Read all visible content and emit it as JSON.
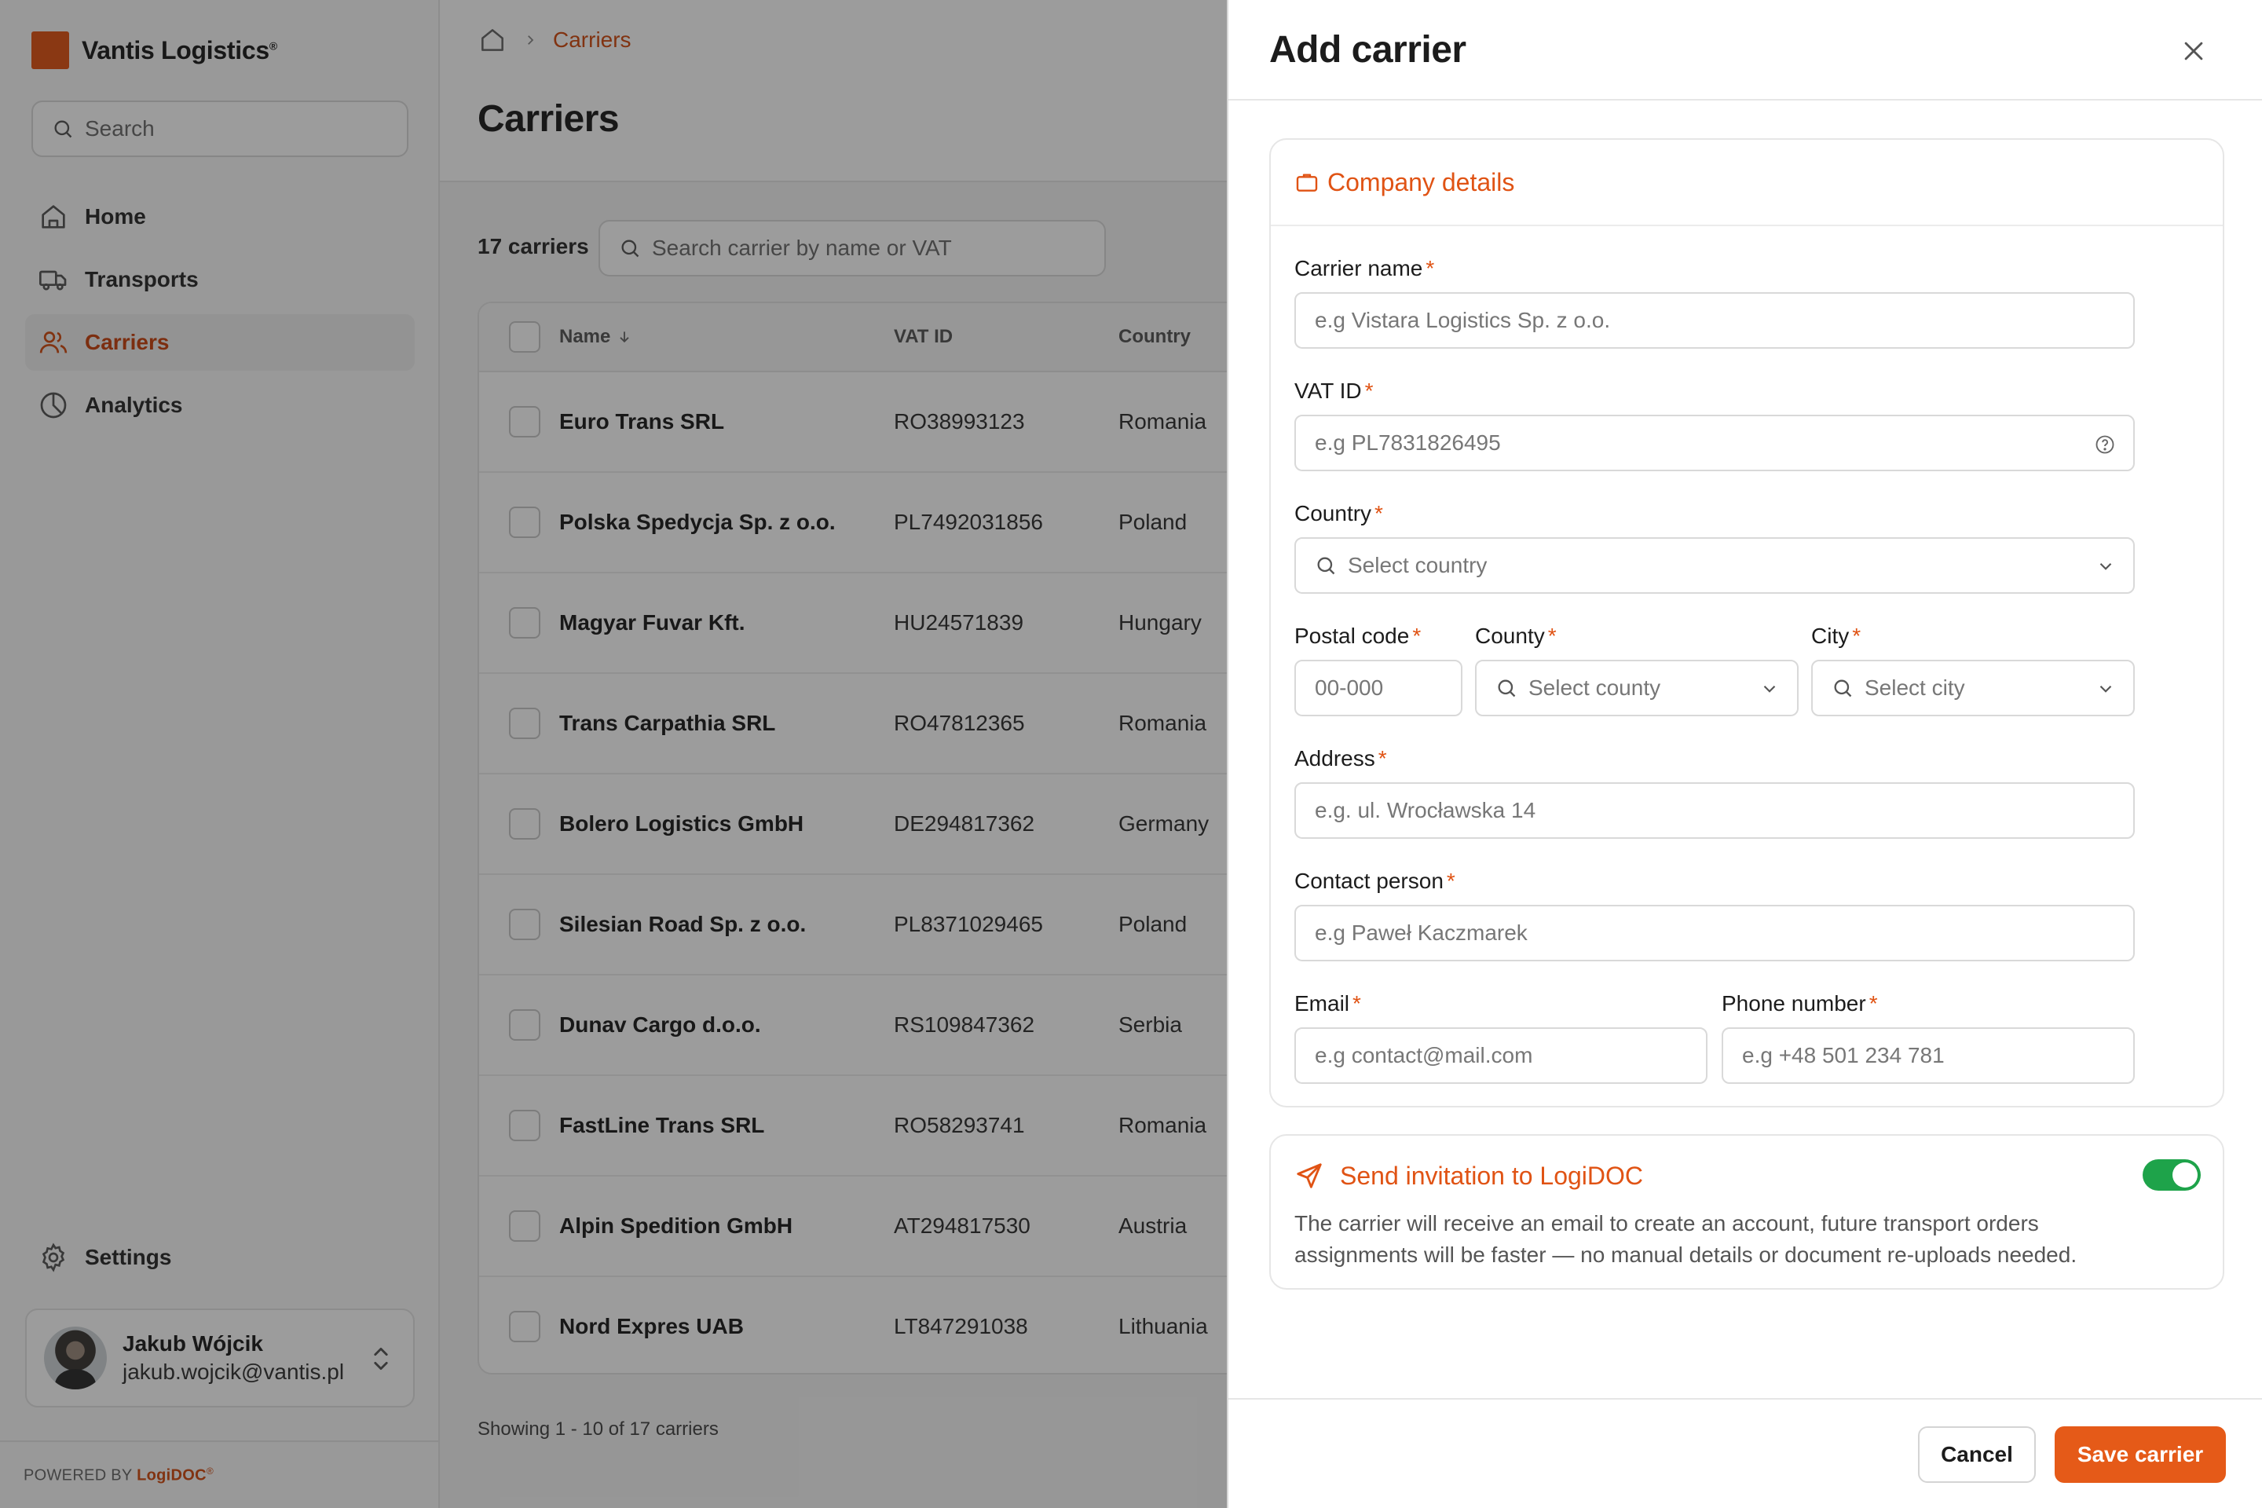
{
  "brand": {
    "name": "Vantis Logistics",
    "mark": "®"
  },
  "sidebar": {
    "search_placeholder": "Search",
    "items": [
      {
        "label": "Home",
        "icon": "home-icon"
      },
      {
        "label": "Transports",
        "icon": "truck-icon"
      },
      {
        "label": "Carriers",
        "icon": "users-icon",
        "active": true
      },
      {
        "label": "Analytics",
        "icon": "pie-chart-icon"
      }
    ],
    "settings_label": "Settings",
    "user": {
      "name": "Jakub Wójcik",
      "email": "jakub.wojcik@vantis.pl"
    },
    "powered_prefix": "POWERED BY",
    "powered_brand": "LogiDOC",
    "powered_mark": "®"
  },
  "main": {
    "breadcrumb": {
      "current": "Carriers"
    },
    "title": "Carriers",
    "count_label": "17 carriers",
    "search_placeholder": "Search carrier by name or VAT",
    "columns": {
      "name": "Name",
      "vat": "VAT ID",
      "country": "Country"
    },
    "rows": [
      {
        "name": "Euro Trans SRL",
        "vat": "RO38993123",
        "country": "Romania"
      },
      {
        "name": "Polska Spedycja Sp. z o.o.",
        "vat": "PL7492031856",
        "country": "Poland"
      },
      {
        "name": "Magyar Fuvar Kft.",
        "vat": "HU24571839",
        "country": "Hungary"
      },
      {
        "name": "Trans Carpathia SRL",
        "vat": "RO47812365",
        "country": "Romania"
      },
      {
        "name": "Bolero Logistics GmbH",
        "vat": "DE294817362",
        "country": "Germany"
      },
      {
        "name": "Silesian Road Sp. z o.o.",
        "vat": "PL8371029465",
        "country": "Poland"
      },
      {
        "name": "Dunav Cargo d.o.o.",
        "vat": "RS109847362",
        "country": "Serbia"
      },
      {
        "name": "FastLine Trans SRL",
        "vat": "RO58293741",
        "country": "Romania"
      },
      {
        "name": "Alpin Spedition GmbH",
        "vat": "AT294817530",
        "country": "Austria"
      },
      {
        "name": "Nord Expres UAB",
        "vat": "LT847291038",
        "country": "Lithuania"
      }
    ],
    "showing": "Showing 1 - 10 of 17 carriers"
  },
  "drawer": {
    "title": "Add carrier",
    "section_title": "Company details",
    "required_mark": "*",
    "fields": {
      "carrier_name": {
        "label": "Carrier name",
        "placeholder": "e.g Vistara Logistics Sp. z o.o."
      },
      "vat_id": {
        "label": "VAT ID",
        "placeholder": "e.g PL7831826495"
      },
      "country": {
        "label": "Country",
        "placeholder": "Select country"
      },
      "postal_code": {
        "label": "Postal code",
        "placeholder": "00-000"
      },
      "county": {
        "label": "County",
        "placeholder": "Select county"
      },
      "city": {
        "label": "City",
        "placeholder": "Select city"
      },
      "address": {
        "label": "Address",
        "placeholder": "e.g. ul. Wrocławska 14"
      },
      "contact_person": {
        "label": "Contact person",
        "placeholder": "e.g Paweł Kaczmarek"
      },
      "email": {
        "label": "Email",
        "placeholder": "e.g contact@mail.com"
      },
      "phone": {
        "label": "Phone number",
        "placeholder": "e.g +48 501 234 781"
      }
    },
    "invite": {
      "title": "Send invitation to LogiDOC",
      "description": "The carrier will receive an email to create an account, future transport orders assignments will be faster — no manual details or document re-uploads needed.",
      "enabled": true
    },
    "cancel_label": "Cancel",
    "save_label": "Save carrier"
  },
  "colors": {
    "accent": "#e05314",
    "toggle_on": "#1ea34a",
    "overlay": "#141414"
  }
}
